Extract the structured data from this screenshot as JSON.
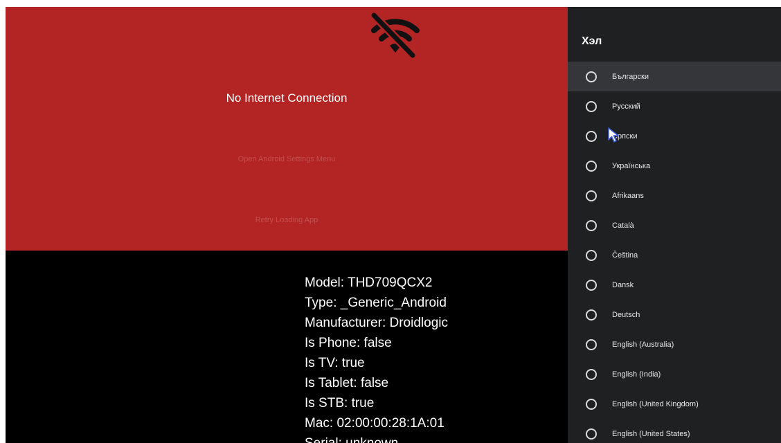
{
  "error": {
    "title": "No Internet Connection",
    "open_settings_label": "Open Android Settings Menu",
    "retry_label": "Retry Loading App",
    "icon": "wifi-off-icon"
  },
  "device_info": [
    "Model: THD709QCX2",
    "Type: _Generic_Android",
    "Manufacturer: Droidlogic",
    "Is Phone: false",
    "Is TV: true",
    "Is Tablet: false",
    "Is STB: true",
    "Mac: 02:00:00:28:1A:01",
    "Serial: unknown"
  ],
  "language_panel": {
    "title": "Хэл",
    "items": [
      {
        "label": "Български",
        "focused": true
      },
      {
        "label": "Русский",
        "focused": false
      },
      {
        "label": "Српски",
        "focused": false
      },
      {
        "label": "Українська",
        "focused": false
      },
      {
        "label": "Afrikaans",
        "focused": false
      },
      {
        "label": "Català",
        "focused": false
      },
      {
        "label": "Čeština",
        "focused": false
      },
      {
        "label": "Dansk",
        "focused": false
      },
      {
        "label": "Deutsch",
        "focused": false
      },
      {
        "label": "English (Australia)",
        "focused": false
      },
      {
        "label": "English (India)",
        "focused": false
      },
      {
        "label": "English (United Kingdom)",
        "focused": false
      },
      {
        "label": "English (United States)",
        "focused": false
      }
    ]
  },
  "colors": {
    "error_background": "#b32424",
    "panel_background": "#1f2022",
    "focused_item": "#35363a"
  }
}
